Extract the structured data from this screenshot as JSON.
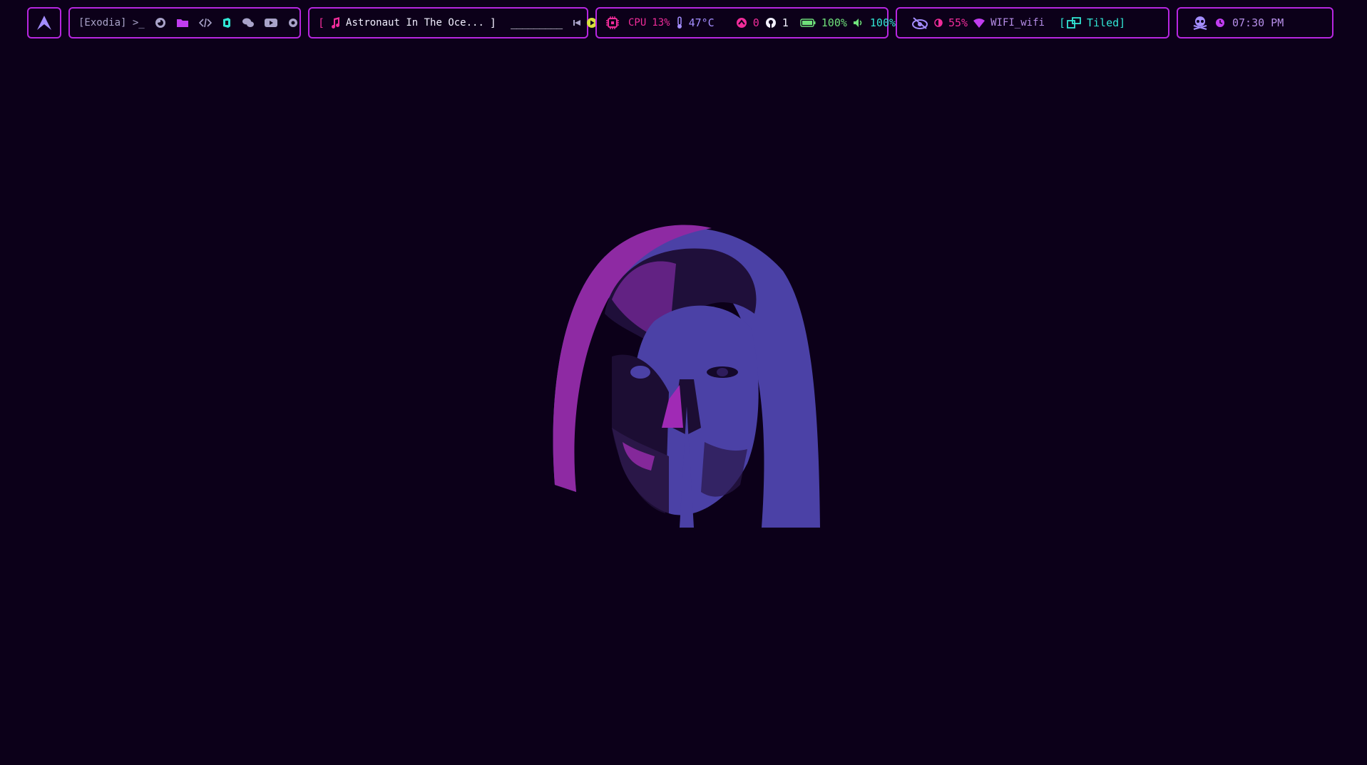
{
  "launcher": {
    "icon": "arch-logo-icon"
  },
  "workspaces": {
    "label": "[Exodia]",
    "prompt": ">_",
    "apps": [
      {
        "name": "firefox-icon"
      },
      {
        "name": "folder-icon"
      },
      {
        "name": "code-icon"
      },
      {
        "name": "office-icon"
      },
      {
        "name": "chat-icon"
      },
      {
        "name": "youtube-icon"
      },
      {
        "name": "settings-icon"
      }
    ]
  },
  "media": {
    "open_bracket": "[",
    "track": "Astronaut In The Oce...",
    "close_bracket": "]",
    "progress": "_________",
    "controls": [
      "previous-icon",
      "play-icon",
      "next-icon"
    ]
  },
  "system": {
    "cpu_label": "CPU",
    "cpu_value": "13%",
    "temperature": "47°C",
    "updates_count": "0",
    "github_count": "1",
    "battery": "100%",
    "volume": "100%"
  },
  "network": {
    "brightness": "55%",
    "wifi_name": "WIFI_wifi",
    "layout_open": "[",
    "layout": "Tiled]"
  },
  "clock": {
    "time": "07:30 PM"
  },
  "colors": {
    "background": "#0c0019",
    "border": "#b726e0",
    "accent_pink": "#f02c9a",
    "accent_violet": "#a48dff",
    "accent_cyan": "#31e6d4",
    "accent_green": "#6fe07a"
  }
}
